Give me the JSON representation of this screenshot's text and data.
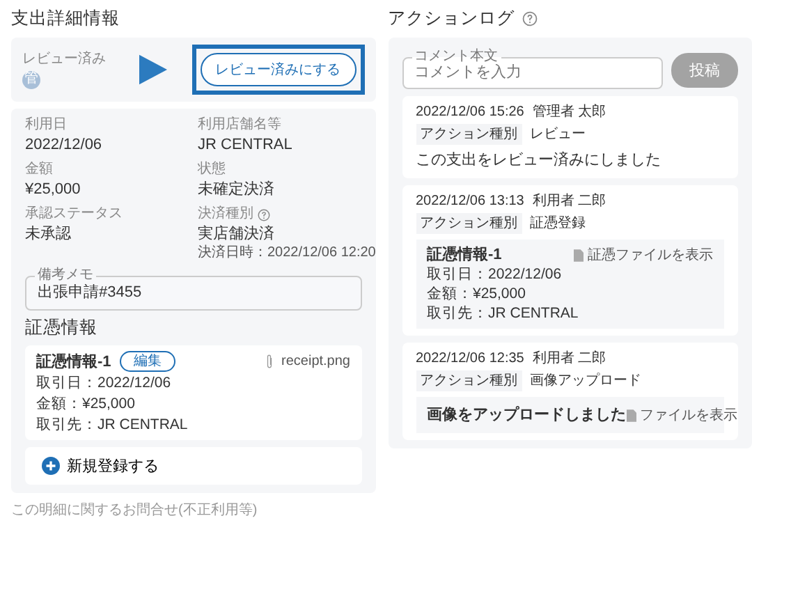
{
  "left": {
    "title": "支出詳細情報",
    "review": {
      "label": "レビュー済み",
      "avatar": "管",
      "button": "レビュー済みにする",
      "highlighted": true
    },
    "fields": [
      {
        "label": "利用日",
        "value": "2022/12/06"
      },
      {
        "label": "利用店舗名等",
        "value": "JR CENTRAL"
      },
      {
        "label": "金額",
        "value": "¥25,000"
      },
      {
        "label": "状態",
        "value": "未確定決済"
      },
      {
        "label": "承認ステータス",
        "value": "未承認"
      },
      {
        "label": "決済種別",
        "value": "実店舗決済",
        "help": true,
        "note": "決済日時：2022/12/06 12:20"
      }
    ],
    "memo": {
      "label": "備考メモ",
      "value": "出張申請#3455"
    },
    "evidence_title": "証憑情報",
    "evidence": [
      {
        "title": "証憑情報-1",
        "edit": "編集",
        "file": "receipt.png",
        "lines": [
          "取引日：2022/12/06",
          "金額：¥25,000",
          "取引先：JR CENTRAL"
        ]
      }
    ],
    "add": "新規登録する",
    "footer_link": "この明細に関するお問合せ(不正利用等)"
  },
  "right": {
    "title": "アクションログ",
    "help": true,
    "comment": {
      "label": "コメント本文",
      "placeholder": "コメントを入力",
      "button": "投稿",
      "disabled": true
    },
    "logs": [
      {
        "kind": "message",
        "time": "2022/12/06 15:26",
        "user": "管理者 太郎",
        "type_label": "アクション種別",
        "type": "レビュー",
        "message": "この支出をレビュー済みにしました"
      },
      {
        "kind": "evidence",
        "time": "2022/12/06 13:13",
        "user": "利用者 二郎",
        "type_label": "アクション種別",
        "type": "証憑登録",
        "title": "証憑情報-1",
        "link": "証憑ファイルを表示",
        "lines": [
          "取引日：2022/12/06",
          "金額：¥25,000",
          "取引先：JR CENTRAL"
        ]
      },
      {
        "kind": "upload",
        "time": "2022/12/06 12:35",
        "user": "利用者 二郎",
        "type_label": "アクション種別",
        "type": "画像アップロード",
        "message": "画像をアップロードしました",
        "link": "ファイルを表示"
      }
    ]
  }
}
